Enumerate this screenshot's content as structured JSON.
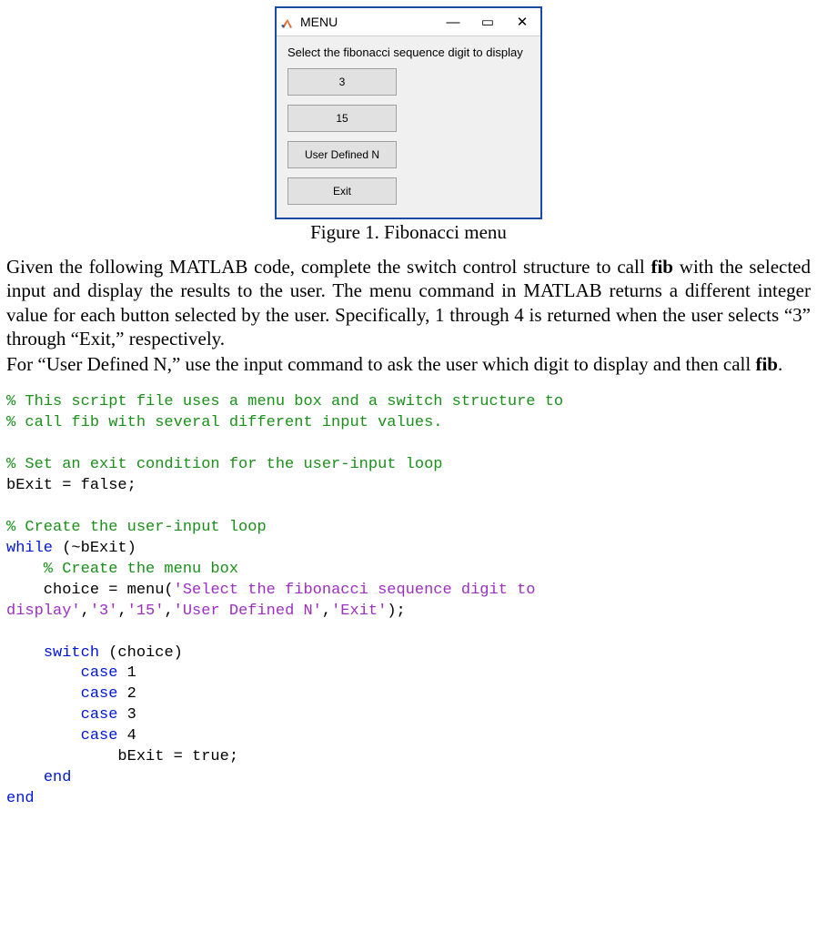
{
  "figure": {
    "window_title": "MENU",
    "prompt": "Select the fibonacci sequence digit to display",
    "buttons": [
      "3",
      "15",
      "User Defined N",
      "Exit"
    ],
    "caption": "Figure 1. Fibonacci menu"
  },
  "prose": {
    "p1_pre": "Given the following MATLAB code, complete the switch control structure to call ",
    "p1_b1": "fib",
    "p1_mid": " with the selected input and display the results to the user. The menu command in MATLAB returns a different integer value for each button selected by the user. Specifically, 1 through 4 is returned when the user selects “3” through “Exit,” respectively.",
    "p2_pre": "For “User Defined N,” use the input command to ask the user which digit to display and then call ",
    "p2_b1": "fib",
    "p2_post": "."
  },
  "code": {
    "c1": "% This script file uses a menu box and a switch structure to",
    "c2": "% call fib with several different input values.",
    "c3": "% Set an exit condition for the user-input loop",
    "l1": "bExit = false;",
    "c4": "% Create the user-input loop",
    "kw_while": "while",
    "l2_rest": " (~bExit)",
    "c5": "    % Create the menu box",
    "l3_a": "    choice = menu(",
    "l3_s1": "'Select the fibonacci sequence digit to \ndisplay'",
    "l3_c1": ",",
    "l3_s2": "'3'",
    "l3_c2": ",",
    "l3_s3": "'15'",
    "l3_c3": ",",
    "l3_s4": "'User Defined N'",
    "l3_c4": ",",
    "l3_s5": "'Exit'",
    "l3_end": ");",
    "kw_switch": "switch",
    "l4_rest": " (choice)",
    "kw_case": "case",
    "case_vals": [
      "1",
      "2",
      "3",
      "4"
    ],
    "l_case4_body": "            bExit = true;",
    "kw_end": "end"
  }
}
